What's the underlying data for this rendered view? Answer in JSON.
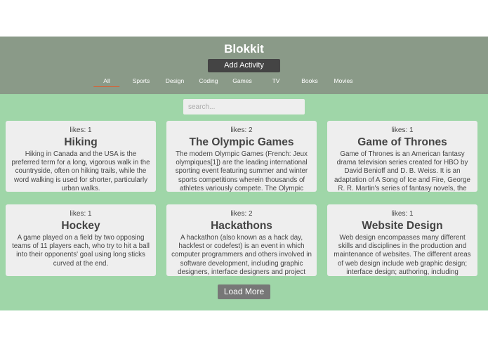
{
  "header": {
    "brand": "Blokkit",
    "add_activity_label": "Add Activity",
    "tabs": [
      "All",
      "Sports",
      "Design",
      "Coding",
      "Games",
      "TV",
      "Books",
      "Movies"
    ],
    "active_tab": "All"
  },
  "search": {
    "placeholder": "search..."
  },
  "cards": [
    {
      "likes": "likes: 1",
      "title": "Hiking",
      "desc": "Hiking in Canada and the USA is the preferred term for a long, vigorous walk in the countryside, often on hiking trails, while the word walking is used for shorter, particularly urban walks."
    },
    {
      "likes": "likes: 2",
      "title": "The Olympic Games",
      "desc": "The modern Olympic Games (French: Jeux olympiques[1]) are the leading international sporting event featuring summer and winter sports competitions wherein thousands of athletes variously compete. The Olympic"
    },
    {
      "likes": "likes: 1",
      "title": "Game of Thrones",
      "desc": "Game of Thrones is an American fantasy drama television series created for HBO by David Benioff and D. B. Weiss. It is an adaptation of A Song of Ice and Fire, George R. R. Martin's series of fantasy novels, the"
    },
    {
      "likes": "likes: 1",
      "title": "Hockey",
      "desc": "A game played on a field by two opposing teams of 11 players each, who try to hit a ball into their opponents' goal using long sticks curved at the end."
    },
    {
      "likes": "likes: 2",
      "title": "Hackathons",
      "desc": "A hackathon (also known as a hack day, hackfest or codefest) is an event in which computer programmers and others involved in software development, including graphic designers, interface designers and project"
    },
    {
      "likes": "likes: 1",
      "title": "Website Design",
      "desc": "Web design encompasses many different skills and disciplines in the production and maintenance of websites. The different areas of web design include web graphic design; interface design; authoring, including"
    }
  ],
  "load_more_label": "Load More"
}
